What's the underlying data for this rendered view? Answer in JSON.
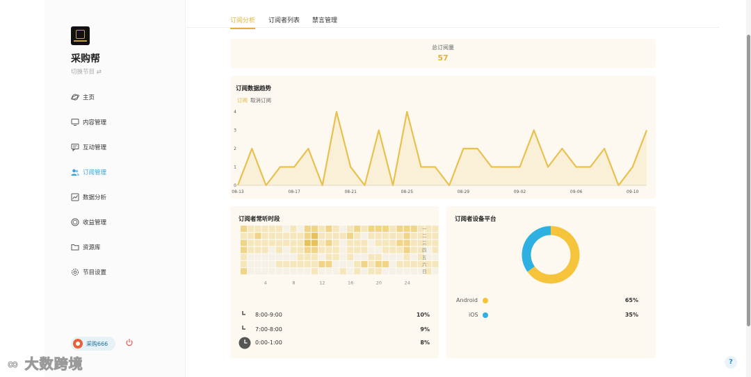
{
  "sidebar": {
    "app_name": "采购帮",
    "switch_label": "切换节目 ⇄",
    "items": [
      {
        "label": "主页",
        "icon": "planet-icon"
      },
      {
        "label": "内容管理",
        "icon": "monitor-icon"
      },
      {
        "label": "互动管理",
        "icon": "chat-icon"
      },
      {
        "label": "订阅管理",
        "icon": "users-icon",
        "active": true
      },
      {
        "label": "数据分析",
        "icon": "chart-icon"
      },
      {
        "label": "收益管理",
        "icon": "coin-icon"
      },
      {
        "label": "资源库",
        "icon": "folder-icon"
      },
      {
        "label": "节目设置",
        "icon": "gear-icon"
      }
    ],
    "user_name": "采购666"
  },
  "watermark": "大数跨境",
  "tabs": [
    {
      "label": "订阅分析",
      "active": true
    },
    {
      "label": "订阅者列表"
    },
    {
      "label": "禁言管理"
    }
  ],
  "summary": {
    "label": "总订阅量",
    "value": "57"
  },
  "trend": {
    "title": "订阅数据趋势",
    "legend_subscribe": "订阅",
    "legend_unsubscribe": "取消订阅"
  },
  "chart_data": {
    "type": "area",
    "x": [
      "08-13",
      "08-14",
      "08-15",
      "08-16",
      "08-17",
      "08-18",
      "08-19",
      "08-20",
      "08-21",
      "08-22",
      "08-23",
      "08-24",
      "08-25",
      "08-26",
      "08-27",
      "08-28",
      "08-29",
      "08-30",
      "08-31",
      "09-01",
      "09-02",
      "09-03",
      "09-04",
      "09-05",
      "09-06",
      "09-07",
      "09-08",
      "09-09",
      "09-10",
      "09-11"
    ],
    "x_tick_labels": [
      "08-13",
      "08-17",
      "08-21",
      "08-25",
      "08-29",
      "09-02",
      "09-06",
      "09-10"
    ],
    "series": [
      {
        "name": "订阅",
        "values": [
          0,
          2,
          0,
          1,
          1,
          2,
          0,
          4,
          1,
          0,
          3,
          0,
          4,
          1,
          1,
          0,
          2,
          2,
          1,
          1,
          1,
          3,
          1,
          2,
          1,
          1,
          2,
          0,
          1,
          3
        ]
      },
      {
        "name": "取消订阅",
        "values": [
          0,
          0,
          0,
          0,
          0,
          0,
          0,
          0,
          0,
          0,
          0,
          0,
          0,
          0,
          0,
          0,
          0,
          0,
          0,
          0,
          0,
          0,
          0,
          0,
          0,
          0,
          0,
          0,
          0,
          0
        ]
      }
    ],
    "ylim": [
      0,
      4
    ],
    "y_ticks": [
      0,
      1,
      2,
      3,
      4
    ],
    "colors": {
      "line": "#e8c04d",
      "fill": "#faf0d8"
    }
  },
  "heatmap": {
    "title": "订阅者常听时段",
    "row_labels": [
      "一",
      "二",
      "三",
      "四",
      "五",
      "六",
      "日"
    ],
    "col_tick_labels": [
      "4",
      "8",
      "12",
      "16",
      "20",
      "24"
    ],
    "levels": [
      [
        2,
        1,
        1,
        1,
        1,
        1,
        0,
        1,
        0,
        2,
        2,
        1,
        2,
        1,
        0,
        1,
        2,
        1,
        2,
        2,
        2,
        1,
        2,
        2,
        2,
        1,
        1,
        1,
        1,
        0
      ],
      [
        1,
        1,
        2,
        1,
        1,
        1,
        1,
        1,
        1,
        2,
        3,
        1,
        1,
        1,
        1,
        2,
        1,
        0,
        1,
        1,
        1,
        1,
        1,
        2,
        1,
        1,
        1,
        1,
        1,
        1
      ],
      [
        2,
        1,
        1,
        1,
        1,
        1,
        1,
        1,
        1,
        3,
        3,
        1,
        2,
        1,
        0,
        1,
        1,
        1,
        0,
        1,
        1,
        1,
        2,
        2,
        1,
        1,
        1,
        1,
        1,
        1
      ],
      [
        2,
        1,
        1,
        1,
        0,
        1,
        0,
        1,
        1,
        2,
        2,
        1,
        1,
        1,
        0,
        1,
        1,
        1,
        0,
        0,
        1,
        1,
        1,
        2,
        1,
        1,
        0,
        1,
        0,
        0
      ],
      [
        1,
        0,
        0,
        0,
        0,
        0,
        0,
        0,
        1,
        1,
        1,
        0,
        1,
        1,
        0,
        1,
        0,
        0,
        1,
        1,
        0,
        0,
        0,
        1,
        0,
        1,
        0,
        0,
        0,
        0
      ],
      [
        1,
        0,
        0,
        0,
        0,
        1,
        1,
        1,
        1,
        1,
        1,
        2,
        2,
        0,
        0,
        0,
        1,
        2,
        1,
        2,
        2,
        0,
        1,
        1,
        1,
        1,
        1,
        1,
        1,
        0
      ],
      [
        2,
        0,
        0,
        0,
        0,
        0,
        0,
        0,
        0,
        0,
        1,
        0,
        0,
        0,
        1,
        0,
        1,
        0,
        1,
        1,
        0,
        0,
        0,
        0,
        0,
        0,
        1,
        0,
        0,
        0
      ]
    ],
    "palette": [
      "#f5f1e6",
      "#f6e6bc",
      "#f0d487",
      "#e6c35a"
    ]
  },
  "top_times": [
    {
      "time": "8:00-9:00",
      "pct": "10%"
    },
    {
      "time": "7:00-8:00",
      "pct": "9%"
    },
    {
      "time": "0:00-1:00",
      "pct": "8%"
    }
  ],
  "devices": {
    "title": "订阅者设备平台",
    "items": [
      {
        "name": "Android",
        "pct": "65%",
        "value": 65,
        "color": "#f5c43a"
      },
      {
        "name": "iOS",
        "pct": "35%",
        "value": 35,
        "color": "#2eb0e0"
      }
    ]
  },
  "help_label": "?"
}
